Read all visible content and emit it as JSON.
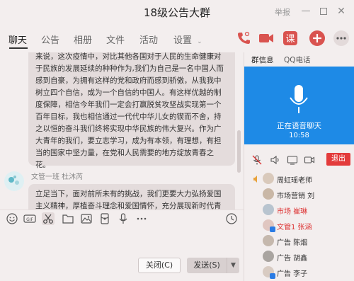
{
  "window": {
    "title": "18级公告大群",
    "report": "举报"
  },
  "tabs": [
    "聊天",
    "公告",
    "相册",
    "文件",
    "活动",
    "设置"
  ],
  "toolbar_icons": [
    "phone-icon",
    "video-icon",
    "class-icon",
    "add-icon",
    "more-icon"
  ],
  "chat": {
    "message1": "来说，这次疫情中，对比其他各国对于人民的生命健康对于民族的发展延续的种种作为,我们为自己是一名中国人而感到自豪，为拥有这样的党和政府而感到骄傲，从我我中树立四个自信，成为一个自信的中国人。有这样优越的制度保障，相信今年我们一定会打赢脱贫攻坚战实现第一个百年目标，我也相信通过一代代中华儿女的锲而不舍，持之以恒的奋斗我们终将实现中华民族的伟大复兴。作为广大青年的我们，要立志学习，成为有本领，有理想，有担当的国家中坚力量，在党和人民需要的地方绽放青春之花。",
    "sender": "文管一班 杜沐芮",
    "message2": "立足当下，面对前所未有的挑战，我们更要大力弘扬爱国主义精神，厚植奋斗理念和爱国情怀，充分展现新时代青年的"
  },
  "input_toolbar_icons": [
    "emoji-icon",
    "gif-icon",
    "scissors-icon",
    "folder-icon",
    "image-icon",
    "red-packet-icon",
    "microphone-icon",
    "more-icon",
    "history-icon"
  ],
  "buttons": {
    "close": "关闭(C)",
    "send": "发送(S)"
  },
  "right_panel": {
    "tabs": [
      "群信息",
      "QQ电话"
    ],
    "voice_status": "正在语音聊天",
    "voice_time": "10:58",
    "exit": "退出"
  },
  "members": [
    {
      "name": "周虹瑶老师",
      "red": false
    },
    {
      "name": "市场营销 刘",
      "red": false
    },
    {
      "name": "市场 崔琳",
      "red": true
    },
    {
      "name": "文管1 张涵",
      "red": true
    },
    {
      "name": "广告 陈烟",
      "red": false
    },
    {
      "name": "广告 胡鑫",
      "red": false
    },
    {
      "name": "广告 李子",
      "red": false
    }
  ],
  "colors": {
    "accent": "#1e8ae6",
    "exit": "#e33b3b",
    "background": "#f3eeee",
    "bubble": "#e4dcdc"
  }
}
